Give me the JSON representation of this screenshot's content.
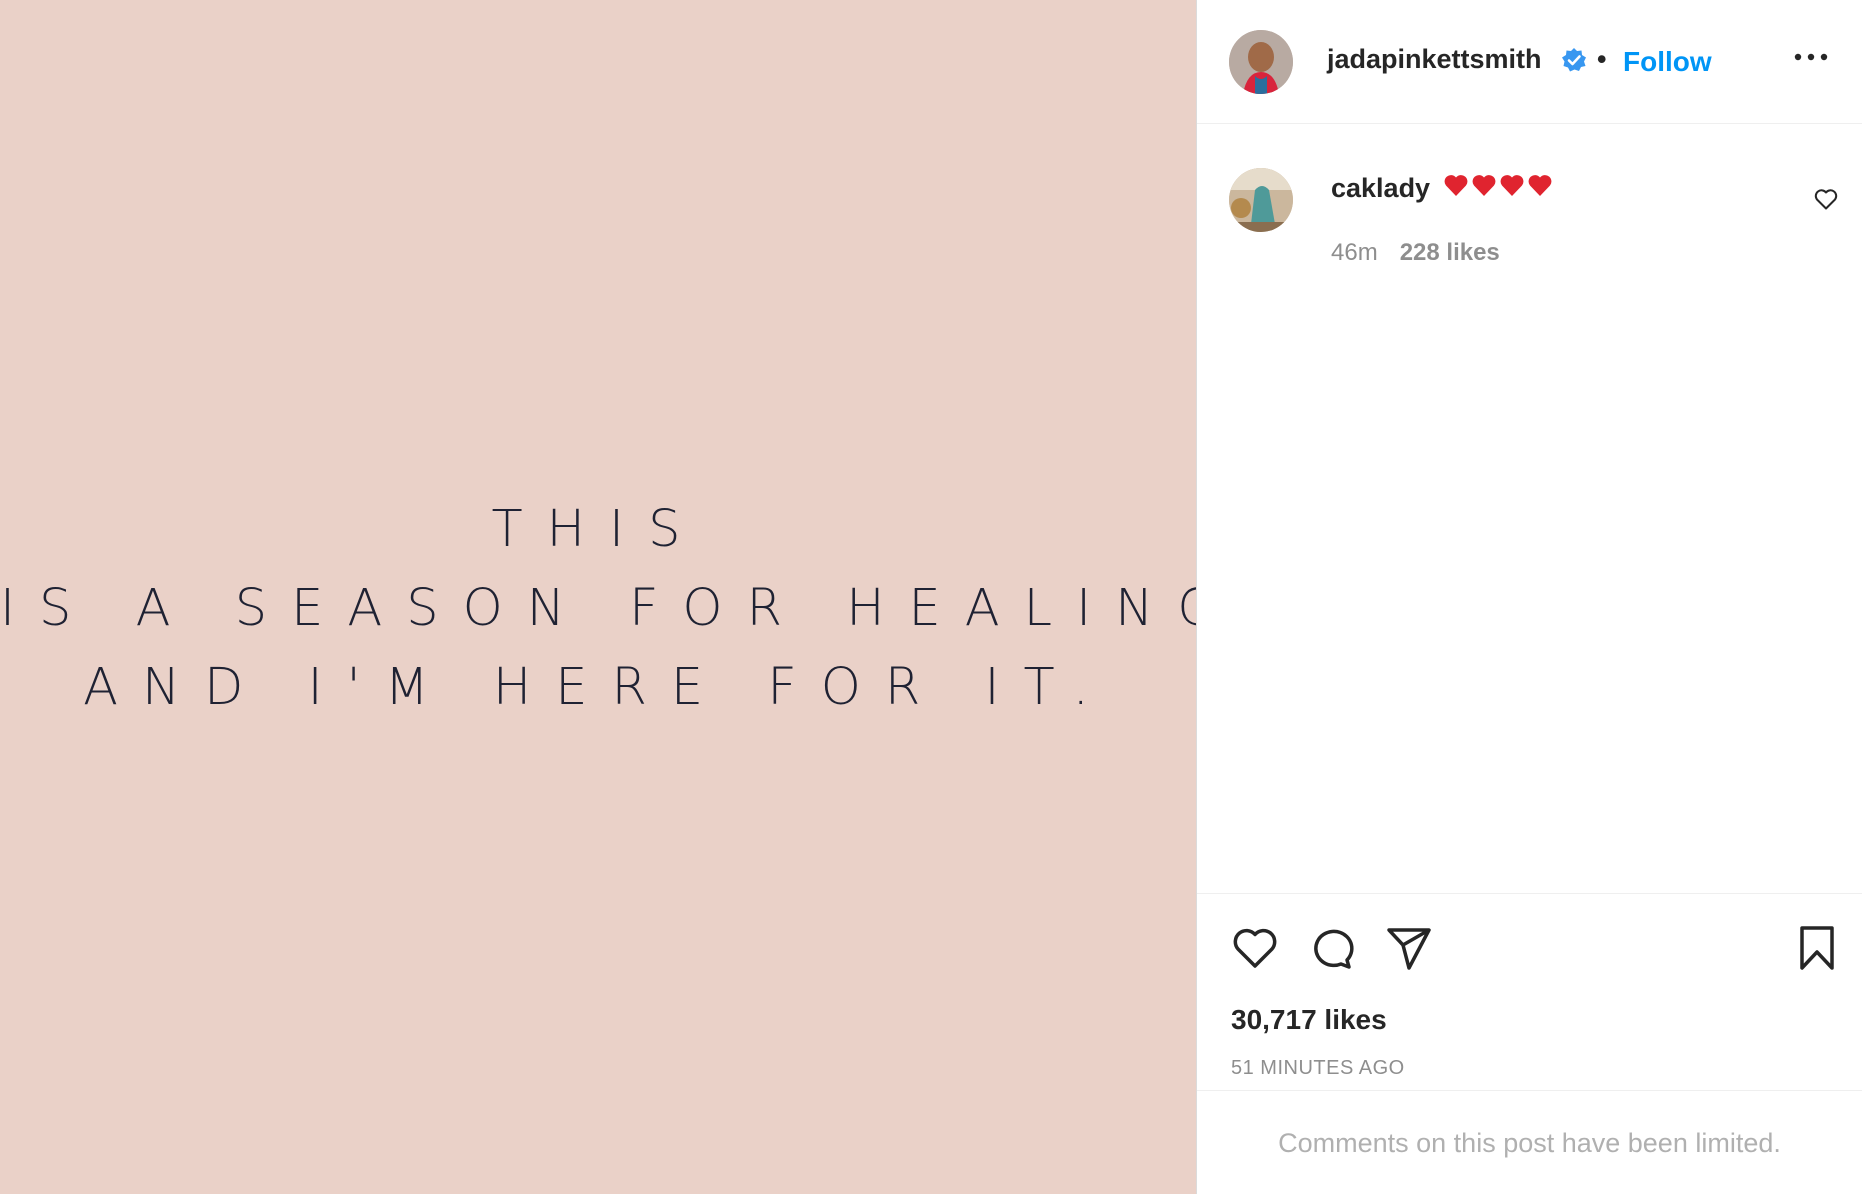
{
  "media": {
    "quote_lines": [
      "THIS",
      "IS A SEASON FOR HEALING",
      "AND I'M HERE FOR IT."
    ],
    "background_color": "#ead1c8"
  },
  "header": {
    "username": "jadapinkettsmith",
    "separator": "•",
    "follow_label": "Follow",
    "verified_icon": "verified-badge-icon",
    "more_icon": "more-options-icon"
  },
  "comment": {
    "username": "caklady",
    "emoji_hearts": [
      "❤️",
      "❤️",
      "❤️",
      "❤️"
    ],
    "time": "46m",
    "likes": "228 likes"
  },
  "actions": {
    "icons": [
      "heart-icon",
      "comment-icon",
      "share-icon",
      "bookmark-icon"
    ],
    "likes_count": "30,717 likes",
    "timestamp": "51 MINUTES AGO"
  },
  "footer": {
    "limited_text": "Comments on this post have been limited."
  },
  "colors": {
    "accent": "#0095f6",
    "heart_red": "#e0242f",
    "muted": "#8e8e8e"
  }
}
